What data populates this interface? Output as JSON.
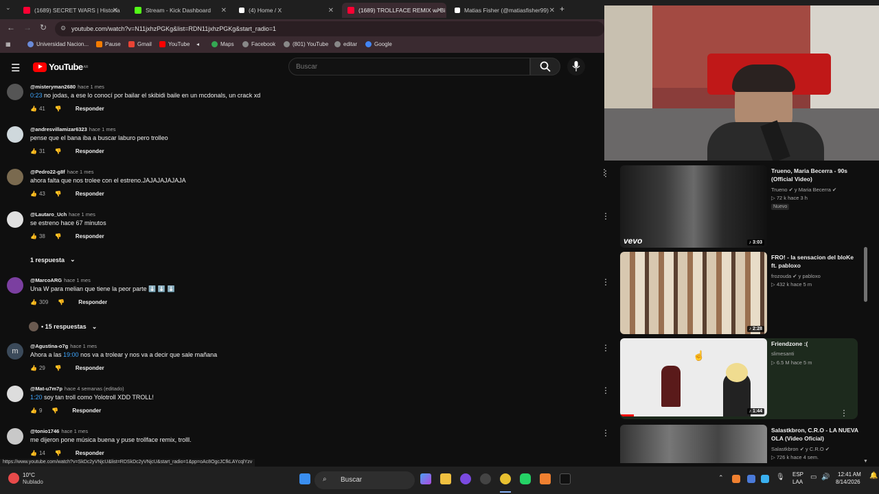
{
  "tabs": [
    {
      "title": "(1689) SECRET WARS | Historia",
      "color": "#ff0033"
    },
    {
      "title": "Stream - Kick Dashboard",
      "color": "#53fc18"
    },
    {
      "title": "(4) Home / X",
      "color": "#ffffff"
    },
    {
      "title": "(1689) TROLLFACE REMIX w/ Bi",
      "color": "#ff0033"
    },
    {
      "title": "Matias Fisher (@matiasfisher99)",
      "color": "#ffffff"
    }
  ],
  "url": "youtube.com/watch?v=N11jxhzPGKg&list=RDN11jxhzPGKg&start_radio=1",
  "bookmarks": [
    {
      "label": "Universidad Nacion...",
      "color": "#6a8ad8"
    },
    {
      "label": "Pause",
      "color": "#f57c00"
    },
    {
      "label": "Gmail",
      "color": "#ea4335"
    },
    {
      "label": "YouTube",
      "color": "#ff0000"
    },
    {
      "label": "Maps",
      "color": "#34a853"
    },
    {
      "label": "Facebook",
      "color": "#888888"
    },
    {
      "label": "(801) YouTube",
      "color": "#888888"
    },
    {
      "label": "editar",
      "color": "#888888"
    },
    {
      "label": "Google",
      "color": "#4285f4"
    }
  ],
  "yt": {
    "logo": "YouTube",
    "region": "AR",
    "search_placeholder": "Buscar"
  },
  "comments": [
    {
      "user": "@misteryman2680",
      "time": "hace 1 mes",
      "ts": "0:23",
      "text": " no jodas, a ese lo conocí por bailar el skibidi baile en un mcdonals, un crack xd",
      "likes": "41",
      "reply": "Responder",
      "avatar": "#555"
    },
    {
      "user": "@andresvillamizar6323",
      "time": "hace 1 mes",
      "ts": "",
      "text": "pense que el bana iba a buscar laburo pero trolleo",
      "likes": "31",
      "reply": "Responder",
      "avatar": "#cfd8dc"
    },
    {
      "user": "@Pedro22-g8f",
      "time": "hace 1 mes",
      "ts": "",
      "text": "ahora falta que nos trolee con el estreno.JAJAJAJAJAJA",
      "likes": "43",
      "reply": "Responder",
      "avatar": "#7a6a4f"
    },
    {
      "user": "@Lautaro_Uch",
      "time": "hace 1 mes",
      "ts": "",
      "text": "se estreno hace 67 minutos",
      "likes": "38",
      "reply": "Responder",
      "avatar": "#e0e0e0"
    },
    {
      "user": "@MarcoARG",
      "time": "hace 1 mes",
      "ts": "",
      "text": "Una W para melian que tiene la peor parte ⬇️ ⬇️ ⬇️",
      "likes": "309",
      "reply": "Responder",
      "avatar": "#7b3fa0"
    },
    {
      "user": "@Agustina-o7g",
      "time": "hace 1 mes",
      "ts": "",
      "text": "Ahora a las ",
      "ts2": "19:00",
      "text2": " nos va a trolear y nos va a decir que sale mañana",
      "likes": "29",
      "reply": "Responder",
      "avatar": "#3b4a5a",
      "letter": "m"
    },
    {
      "user": "@Mat-u7m7p",
      "time": "hace 4 semanas (editado)",
      "ts": "1:20",
      "text": " soy tan troll como Yolotroll XDD TROLL!",
      "likes": "9",
      "reply": "Responder",
      "avatar": "#ddd"
    },
    {
      "user": "@tonio1746",
      "time": "hace 1 mes",
      "ts": "",
      "text": "me dijeron pone música buena y puse trollface remix, trolll.",
      "likes": "14",
      "reply": "Responder",
      "avatar": "#c8c8c8"
    }
  ],
  "reply_toggles": [
    "1 respuesta",
    "• 15 respuestas"
  ],
  "videos": [
    {
      "title": "Trueno, Maria Becerra - 90s (Official Video)",
      "channel": "Trueno ✔ y Maria Becerra ✔",
      "views": "▷ 72 k  hace 3 h",
      "badge": "Nuevo",
      "duration": "♪ 3:03",
      "thumb": "#2d2d2d"
    },
    {
      "title": "FRO! - la sensacion del bloKe ft. pabloxo",
      "channel": "frozouda ✔ y pabloxo",
      "views": "▷ 432 k  hace 5 m",
      "badge": "",
      "duration": "♪ 2:28",
      "thumb": "#8a6a50"
    },
    {
      "title": "Friendzone :(",
      "channel": "slimesanti",
      "views": "▷ 6.5 M  hace 5 m",
      "badge": "",
      "duration": "♪ 1:44",
      "thumb": "#e8e8e8"
    },
    {
      "title": "Salastkbron, C.R.O - LA NUEVA OLA (Video Oficial)",
      "channel": "Salastkbron ✔ y C.R.O ✔",
      "views": "▷ 726 k  hace 4 sem.",
      "badge": "",
      "duration": "",
      "thumb": "#555"
    }
  ],
  "vevo_label": "vevo",
  "status_url": "https://www.youtube.com/watch?v=SkDc2yVNjcU&list=RDSkDc2yVNjcU&start_radio=1&pp=oAc8OgcJCfkLAYcqlYzv",
  "weather": {
    "temp": "10°C",
    "desc": "Nublado"
  },
  "taskbar": {
    "search": "Buscar",
    "lang": "ESP",
    "lang2": "LAA",
    "time": "12:41 AM",
    "date": "8/14/2026"
  }
}
